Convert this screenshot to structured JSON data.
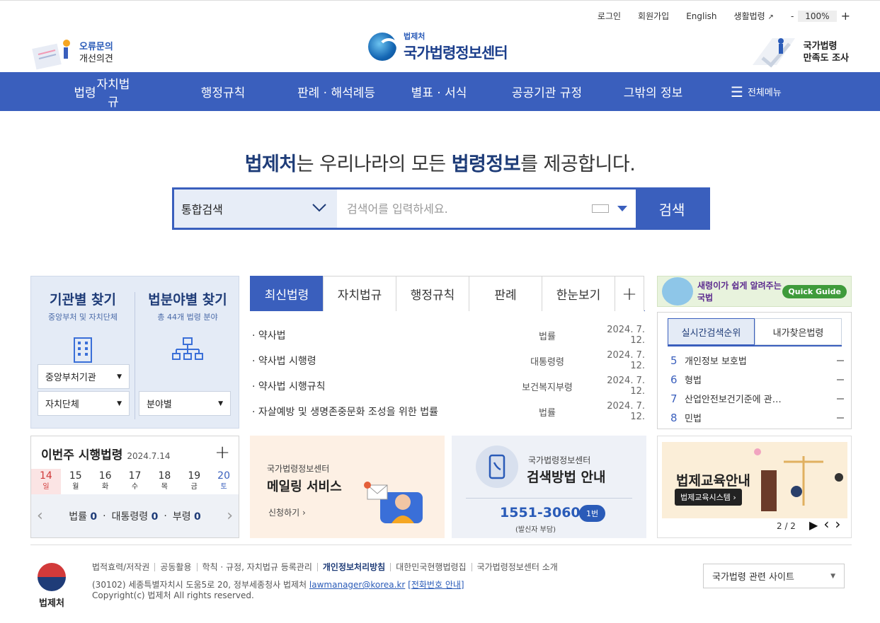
{
  "util": {
    "login": "로그인",
    "signup": "회원가입",
    "english": "English",
    "life_law": "생활법령",
    "zoom_minus": "-",
    "zoom": "100%",
    "zoom_plus": "+"
  },
  "header": {
    "left_promo": [
      "오류문의",
      "개선의견"
    ],
    "logo_sub": "법제처",
    "logo_main": "국가법령정보센터",
    "right_promo": [
      "국가법령",
      "만족도 조사"
    ]
  },
  "nav": {
    "items": [
      "법령",
      "자치법규",
      "행정규칙",
      "판례 · 해석례등",
      "별표 · 서식",
      "공공기관 규정",
      "그밖의 정보"
    ],
    "all_menu": "전체메뉴"
  },
  "headline": {
    "b1": "법제처",
    "t1": "는 우리나라의 모든 ",
    "b2": "법령정보",
    "t2": "를 제공합니다."
  },
  "search": {
    "scope": "통합검색",
    "placeholder": "검색어를 입력하세요.",
    "button": "검색"
  },
  "finder": {
    "agency_title": "기관별 찾기",
    "agency_desc": "중앙부처 및 자치단체",
    "field_title": "법분야별 찾기",
    "field_desc": "총 44개 법령 분야",
    "sel_central": "중앙부처기관",
    "sel_local": "자치단체",
    "sel_field": "분야별"
  },
  "tabs": [
    "최신법령",
    "자치법규",
    "행정규칙",
    "판례",
    "한눈보기"
  ],
  "tab_plus": "+",
  "laws": [
    {
      "name": "· 약사법",
      "type": "법률",
      "date": "2024. 7. 12."
    },
    {
      "name": "· 약사법 시행령",
      "type": "대통령령",
      "date": "2024. 7. 12."
    },
    {
      "name": "· 약사법 시행규칙",
      "type": "보건복지부령",
      "date": "2024. 7. 12."
    },
    {
      "name": "· 자살예방 및 생명존중문화 조성을 위한 법률",
      "type": "법률",
      "date": "2024. 7. 12."
    }
  ],
  "quick": {
    "text": "새령이가 쉽게 알려주는 국법",
    "badge": "Quick Guide"
  },
  "rank": {
    "tab_live": "실시간검색순위",
    "tab_fav": "내가찾은법령",
    "items": [
      {
        "num": "5",
        "name": "개인정보 보호법"
      },
      {
        "num": "6",
        "name": "형법"
      },
      {
        "num": "7",
        "name": "산업안전보건기준에 관…"
      },
      {
        "num": "8",
        "name": "민법"
      }
    ]
  },
  "week": {
    "title": "이번주 시행법령",
    "date": "2024.7.14",
    "plus": "+",
    "days": [
      {
        "d": "14",
        "w": "일"
      },
      {
        "d": "15",
        "w": "월"
      },
      {
        "d": "16",
        "w": "화"
      },
      {
        "d": "17",
        "w": "수"
      },
      {
        "d": "18",
        "w": "목"
      },
      {
        "d": "19",
        "w": "금"
      },
      {
        "d": "20",
        "w": "토"
      }
    ],
    "law_label": "법률",
    "law_count": "0",
    "decree_label": "대통령령",
    "decree_count": "0",
    "ordinance_label": "부령",
    "ordinance_count": "0",
    "prev": "‹",
    "next": "›"
  },
  "mail": {
    "s1": "국가법령정보센터",
    "s2": "메일링 서비스",
    "s3": "신청하기 ›"
  },
  "guide": {
    "g1": "국가법령정보센터",
    "g2": "검색방법 안내",
    "tel": "1551-3060",
    "n1": "1번",
    "cost": "(발신자 부담)"
  },
  "edu": {
    "e1": "법제교육안내",
    "e2": "법제교육시스템 ›",
    "pg": "2 / 2",
    "play": "▶",
    "prev": "‹",
    "next": "›"
  },
  "footer": {
    "org": "법제처",
    "links": [
      "법적효력/저작권",
      "공동활용",
      "학칙 · 규정, 자치법규 등록관리",
      "개인정보처리방침",
      "대한민국현행법령집",
      "국가법령정보센터 소개"
    ],
    "addr": "(30102) 세종특별자치시 도움5로 20, 정부세종청사 법제처",
    "email": "lawmanager@korea.kr",
    "phone": "[전화번호 안내]",
    "copyright": "Copyright(c) 법제처 All rights reserved.",
    "site_select": "국가법령 관련 사이트"
  }
}
